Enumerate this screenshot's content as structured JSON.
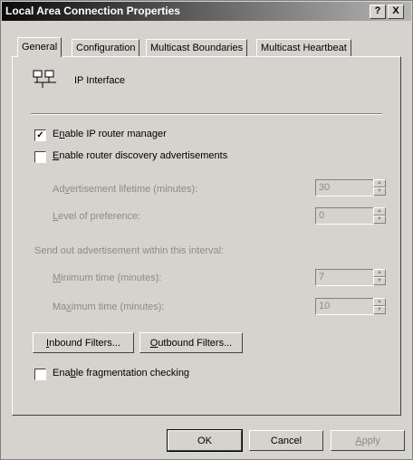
{
  "window": {
    "title": "Local Area Connection Properties",
    "help_btn": "?",
    "close_btn": "X"
  },
  "tabs": [
    "General",
    "Configuration",
    "Multicast Boundaries",
    "Multicast Heartbeat"
  ],
  "header": {
    "label": "IP Interface",
    "icon": "network-interface-icon"
  },
  "options": {
    "enable_ip_router_manager": {
      "pre": "E",
      "ul": "n",
      "post": "able IP router manager",
      "checked": true
    },
    "enable_router_discovery": {
      "pre": "",
      "ul": "E",
      "post": "nable router discovery advertisements",
      "checked": false
    },
    "enable_fragmentation": {
      "pre": "Ena",
      "ul": "b",
      "post": "le fragmentation checking",
      "checked": false
    }
  },
  "fields": {
    "adv_lifetime": {
      "pre": "Ad",
      "ul": "v",
      "post": "ertisement lifetime (minutes):",
      "value": "30"
    },
    "level_pref": {
      "pre": "",
      "ul": "L",
      "post": "evel of preference:",
      "value": "0"
    },
    "interval_heading": "Send out advertisement within this interval:",
    "min_time": {
      "pre": "",
      "ul": "M",
      "post": "inimum time (minutes):",
      "value": "7"
    },
    "max_time": {
      "pre": "Ma",
      "ul": "x",
      "post": "imum time (minutes):",
      "value": "10"
    }
  },
  "buttons": {
    "inbound": {
      "pre": "",
      "ul": "I",
      "post": "nbound Filters..."
    },
    "outbound": {
      "pre": "",
      "ul": "O",
      "post": "utbound Filters..."
    },
    "ok": "OK",
    "cancel": "Cancel",
    "apply": {
      "pre": "",
      "ul": "A",
      "post": "pply"
    }
  },
  "colors": {
    "face": "#d6d3ce",
    "disabled_text": "#8e8b86"
  }
}
